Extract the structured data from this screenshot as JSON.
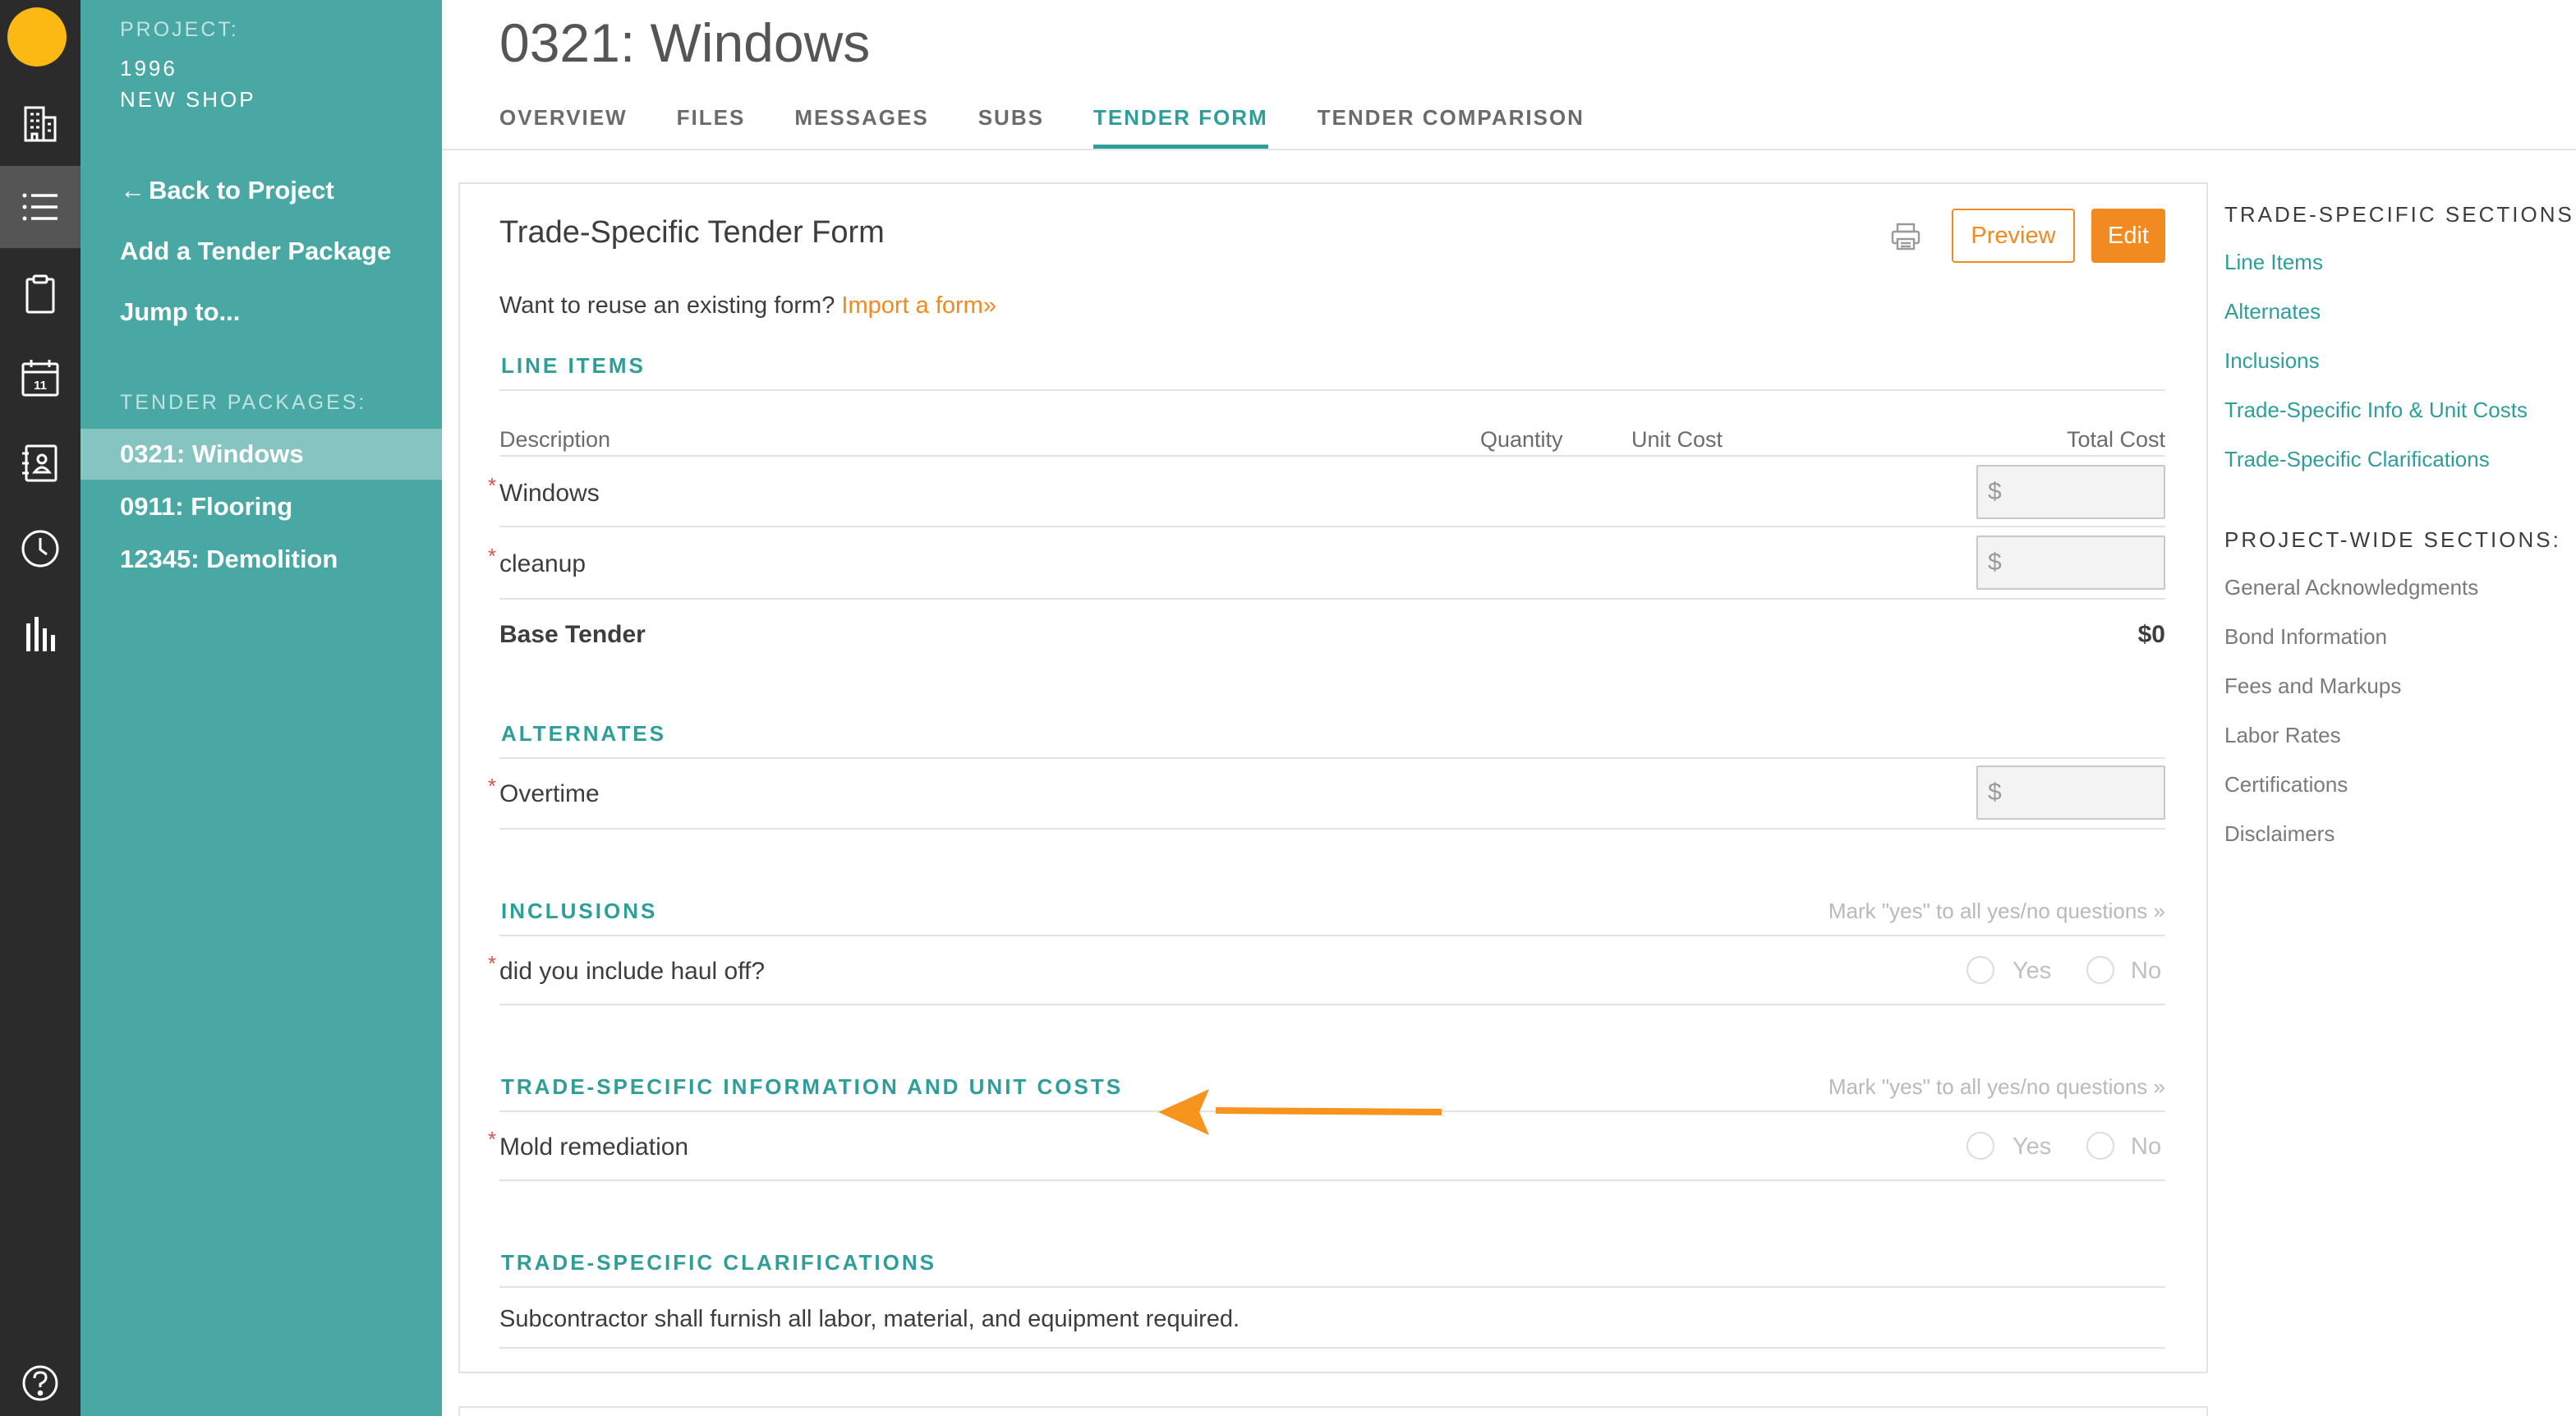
{
  "project": {
    "label": "PROJECT:",
    "number": "1996",
    "name": "NEW SHOP"
  },
  "sidebar": {
    "back": "Back to Project",
    "add_package": "Add a Tender Package",
    "jump": "Jump to...",
    "packages_label": "TENDER PACKAGES:",
    "packages": [
      "0321: Windows",
      "0911: Flooring",
      "12345: Demolition"
    ]
  },
  "page": {
    "title": "0321: Windows",
    "tabs": [
      "OVERVIEW",
      "FILES",
      "MESSAGES",
      "SUBS",
      "TENDER FORM",
      "TENDER COMPARISON"
    ],
    "active_tab": "TENDER FORM"
  },
  "form": {
    "title": "Trade-Specific Tender Form",
    "preview_label": "Preview",
    "edit_label": "Edit",
    "reuse_text": "Want to reuse an existing form?",
    "import_link": "Import a form»",
    "line_items": {
      "heading": "LINE ITEMS",
      "columns": {
        "description": "Description",
        "quantity": "Quantity",
        "unit_cost": "Unit Cost",
        "total_cost": "Total Cost"
      },
      "rows": [
        "Windows",
        "cleanup"
      ],
      "base_label": "Base Tender",
      "base_value": "$0"
    },
    "alternates": {
      "heading": "ALTERNATES",
      "rows": [
        "Overtime"
      ]
    },
    "inclusions": {
      "heading": "INCLUSIONS",
      "mark_all": "Mark \"yes\" to all yes/no questions »",
      "rows": [
        "did you include haul off?"
      ]
    },
    "trade_info": {
      "heading": "TRADE-SPECIFIC INFORMATION AND UNIT COSTS",
      "mark_all": "Mark \"yes\" to all yes/no questions »",
      "rows": [
        "Mold remediation"
      ]
    },
    "clarifications": {
      "heading": "TRADE-SPECIFIC CLARIFICATIONS",
      "text": "Subcontractor shall furnish all labor, material, and equipment required."
    },
    "currency_symbol": "$",
    "required_mark": "*",
    "yes_label": "Yes",
    "no_label": "No"
  },
  "right_nav": {
    "trade_heading": "TRADE-SPECIFIC SECTIONS",
    "trade_links": [
      "Line Items",
      "Alternates",
      "Inclusions",
      "Trade-Specific Info & Unit Costs",
      "Trade-Specific Clarifications"
    ],
    "project_heading": "PROJECT-WIDE SECTIONS:",
    "project_links": [
      "General Acknowledgments",
      "Bond Information",
      "Fees and Markups",
      "Labor Rates",
      "Certifications",
      "Disclaimers"
    ]
  },
  "icons": {
    "rail": [
      "building-icon",
      "list-icon",
      "clipboard-icon",
      "calendar-icon",
      "address-book-icon",
      "clock-icon",
      "bar-chart-icon",
      "help-icon"
    ],
    "calendar_day": "11"
  },
  "colors": {
    "teal": "#49a8a4",
    "accent_teal": "#2e9e99",
    "orange": "#f18a21",
    "rail": "#2b2b2b",
    "logo": "#fdb913"
  }
}
